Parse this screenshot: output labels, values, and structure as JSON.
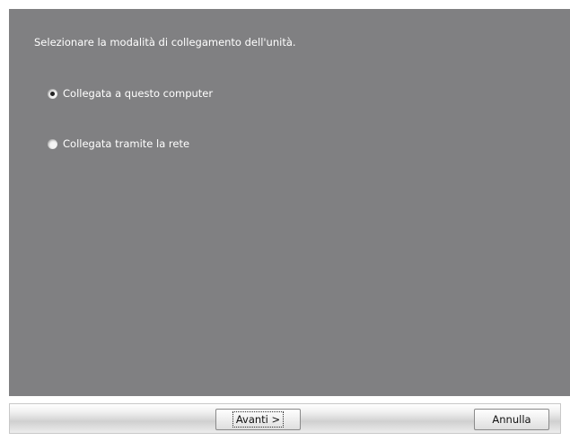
{
  "wizard": {
    "instruction": "Selezionare la modalità di collegamento dell'unità.",
    "options": [
      {
        "label": "Collegata a questo computer",
        "selected": true
      },
      {
        "label": "Collegata tramite la rete",
        "selected": false
      }
    ]
  },
  "footer": {
    "next_label": "Avanti >",
    "cancel_label": "Annulla"
  },
  "colors": {
    "panel_background": "#808082",
    "text": "#ffffff"
  }
}
